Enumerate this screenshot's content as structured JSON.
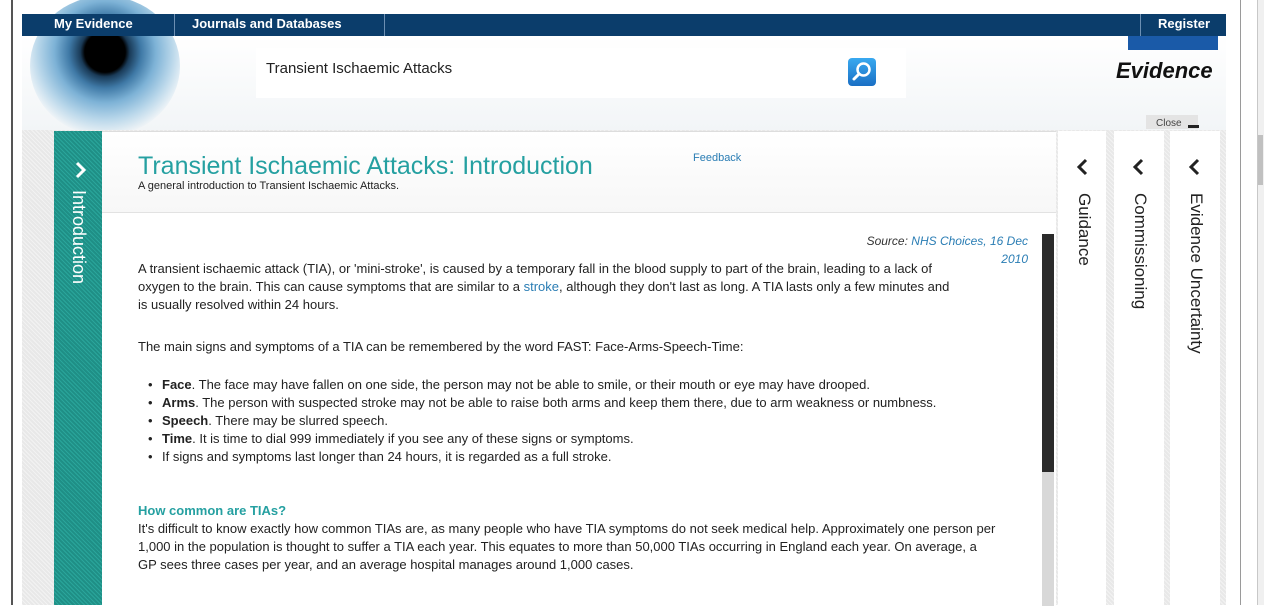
{
  "nav": {
    "my_evidence": "My Evidence",
    "journals": "Journals and Databases",
    "register": "Register"
  },
  "search": {
    "value": "Transient Ischaemic Attacks",
    "button_icon": "search-icon"
  },
  "logo": {
    "text": "Evidence",
    "brand_color": "#1a5aa8"
  },
  "close": {
    "label": "Close"
  },
  "left_tab": {
    "label": "Introduction",
    "icon": "chevron-right-icon"
  },
  "article": {
    "title": "Transient Ischaemic Attacks: Introduction",
    "feedback": "Feedback",
    "subtitle": "A general introduction to Transient Ischaemic Attacks.",
    "source_prefix": "Source: ",
    "source_link": "NHS Choices, 16 Dec 2010",
    "p1_part1": "A transient ischaemic attack (TIA), or 'mini-stroke', is caused by a temporary fall in the blood supply to part of the brain, leading to a lack of oxygen to the brain. This can cause symptoms that are similar to a ",
    "p1_link": "stroke",
    "p1_part2": ", although they don't last as long. A TIA lasts only a few minutes and is usually resolved within 24 hours.",
    "p2": "The main signs and symptoms of a TIA can be remembered by the word FAST: Face-Arms-Speech-Time:",
    "signs": [
      {
        "term": "Face",
        "text": ". The face may have fallen on one side, the person may not be able to smile, or their mouth or eye may have drooped."
      },
      {
        "term": "Arms",
        "text": ". The person with suspected stroke may not be able to raise both arms and keep them there, due to arm weakness or numbness."
      },
      {
        "term": "Speech",
        "text": ". There may be slurred speech."
      },
      {
        "term": "Time",
        "text": ". It is time to dial 999 immediately if you see any of these signs or symptoms."
      }
    ],
    "after_list": "If signs and symptoms last longer than 24 hours, it is regarded as a full stroke.",
    "heading2": "How common are TIAs?",
    "p3": "It's difficult to know exactly how common TIAs are, as many people who have TIA symptoms do not seek medical help. Approximately one person per 1,000 in the population is thought to suffer a TIA each year. This equates to more than 50,000 TIAs occurring in England each year. On average, a GP sees three cases per year, and an average hospital manages around 1,000 cases.",
    "accent_color": "#25a0a1",
    "link_color": "#2a7db4"
  },
  "side_tabs": [
    {
      "label": "Guidance",
      "icon": "chevron-left-icon"
    },
    {
      "label": "Commissioning",
      "icon": "chevron-left-icon"
    },
    {
      "label": "Evidence Uncertainty",
      "icon": "chevron-left-icon"
    }
  ]
}
